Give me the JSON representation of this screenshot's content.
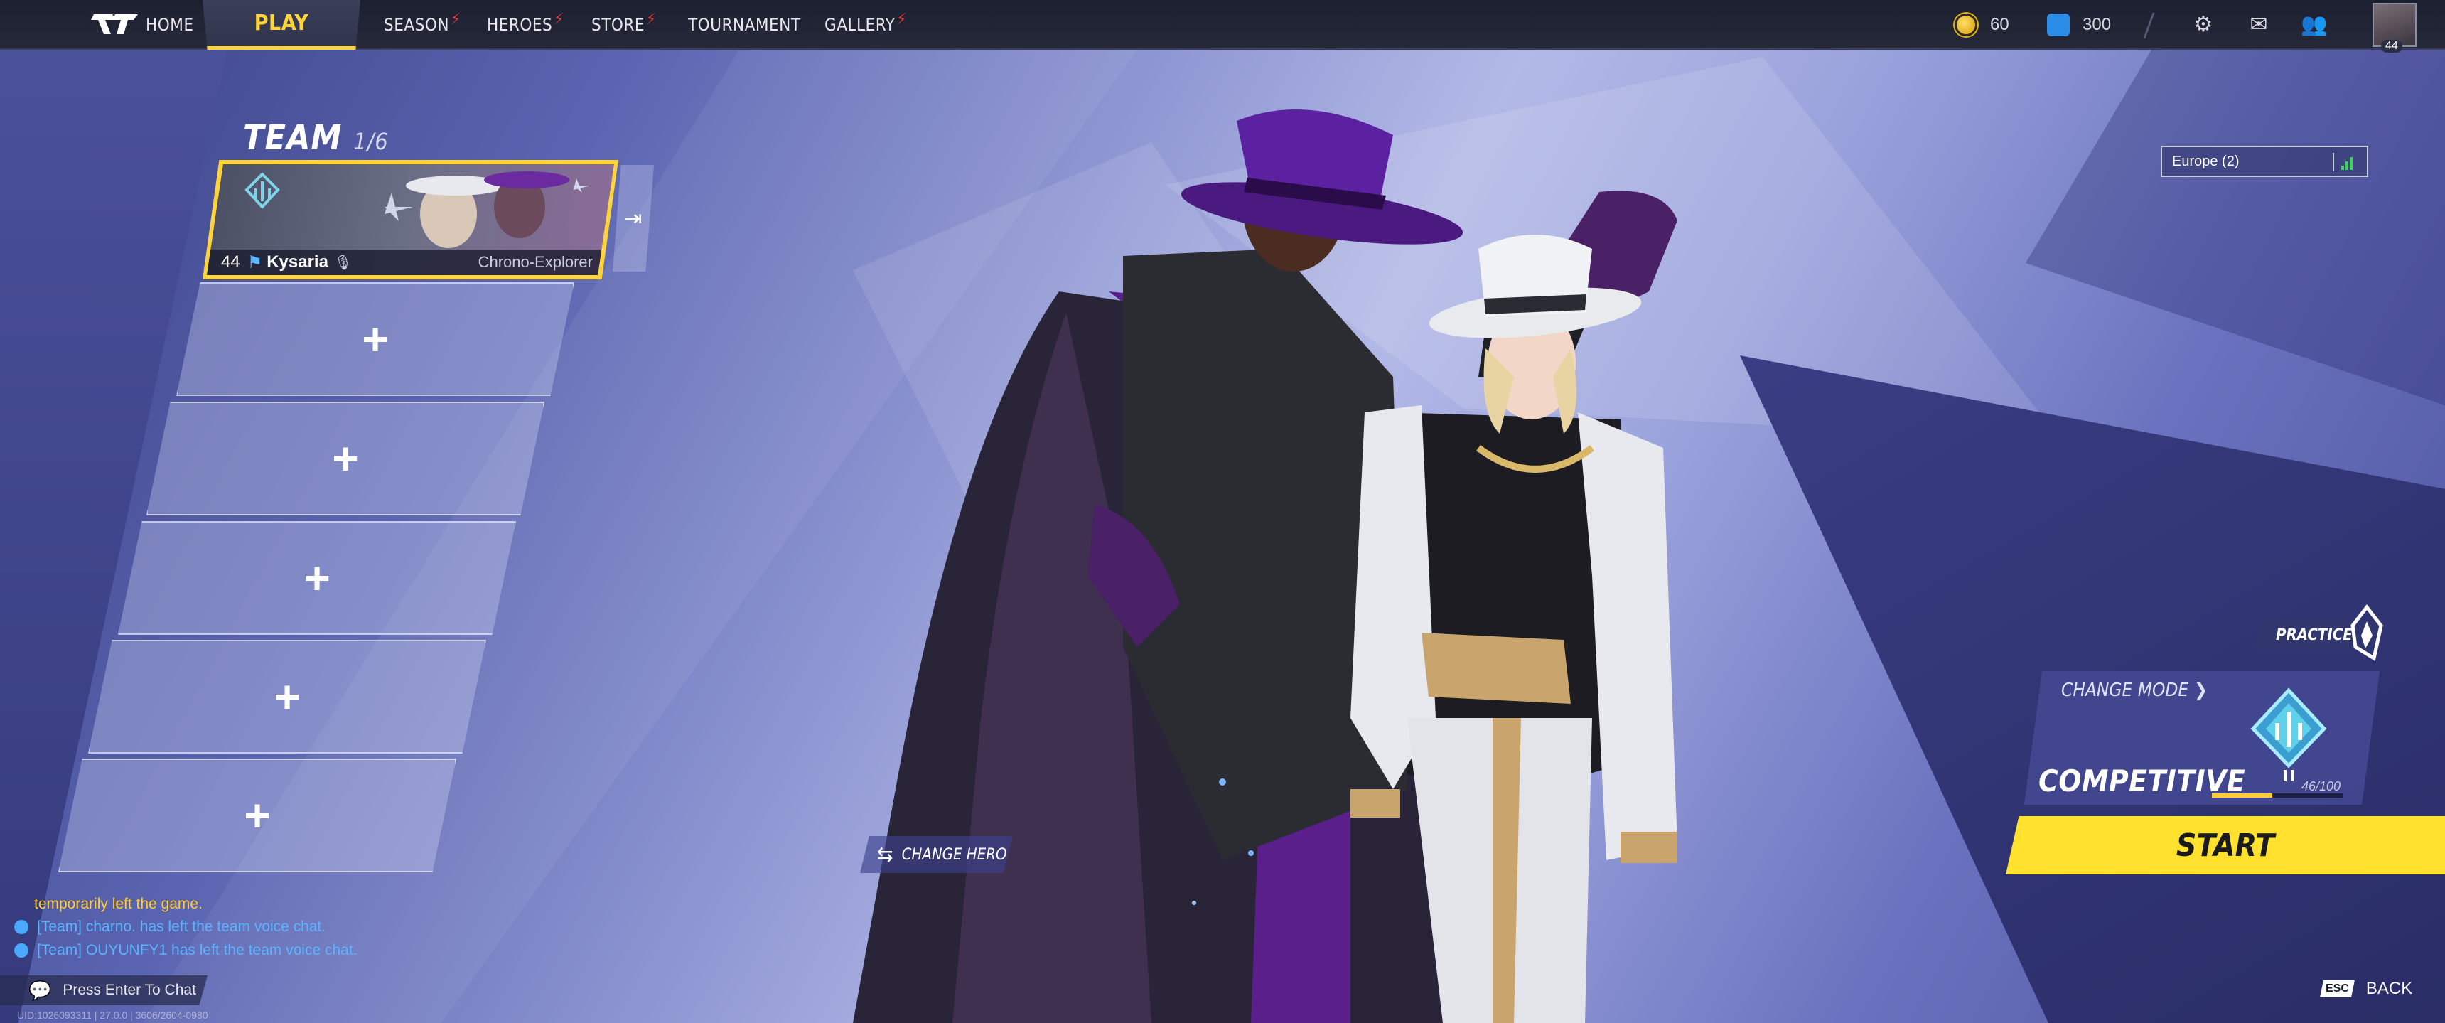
{
  "nav": {
    "home": "HOME",
    "play": "PLAY",
    "season": "SEASON",
    "heroes": "HEROES",
    "store": "STORE",
    "tournament": "TOURNAMENT",
    "gallery": "GALLERY"
  },
  "currency": {
    "gold": "60",
    "units": "300"
  },
  "profile": {
    "level": "44"
  },
  "team": {
    "title": "TEAM",
    "count": "1/6",
    "player": {
      "level": "44",
      "name": "Kysaria",
      "title": "Chrono-Explorer"
    },
    "empty_slot_label": "+"
  },
  "server": {
    "label": "Europe (2)"
  },
  "mode": {
    "practice_label": "PRACTICE",
    "change_mode_label": "CHANGE MODE",
    "mode_name": "COMPETITIVE",
    "progress_text": "46/100",
    "progress_fraction": 0.46,
    "start_label": "START"
  },
  "hero": {
    "change_hero_label": "CHANGE HERO"
  },
  "chat": {
    "lines": [
      "temporarily left the game.",
      "[Team] charno. has left the team voice chat.",
      "[Team] OUYUNFY1 has left the team voice chat."
    ],
    "input_label": "Press Enter To Chat",
    "uid": "UID:1026093311 | 27.0.0 | 3606/2604-0980"
  },
  "footer": {
    "esc_key": "ESC",
    "back_label": "BACK"
  },
  "colors": {
    "accent": "#ffd43a",
    "start": "#ffe12e",
    "chat_team": "#5ab4ff",
    "chat_system": "#ffcc33"
  }
}
